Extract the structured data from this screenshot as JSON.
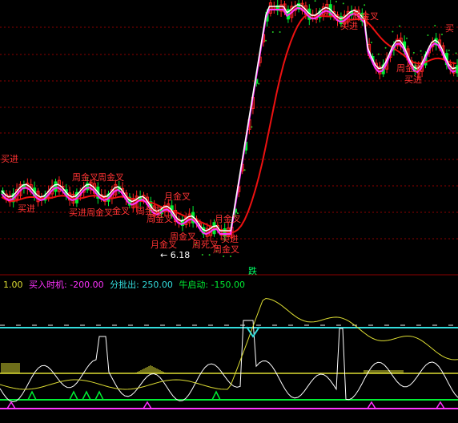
{
  "colors": {
    "background": "#000000",
    "grid": "#8b0000",
    "up_candle": "#ff2222",
    "down_candle": "#00ee33",
    "ma_white": "#ffffff",
    "ma_magenta": "#ff33ff",
    "ma_red": "#ee1111",
    "dots": "#22cc22",
    "cyan": "#33dddd",
    "yellow": "#dddd33",
    "green_line": "#00ee33",
    "magenta_line": "#ff33ff"
  },
  "main_chart": {
    "annotations": [
      {
        "id": "a1",
        "text": "买进"
      },
      {
        "id": "a2",
        "text": "买进"
      },
      {
        "id": "a3",
        "text": "周金叉"
      },
      {
        "id": "a4",
        "text": "周金叉"
      },
      {
        "id": "a5",
        "text": "月金叉"
      },
      {
        "id": "a6",
        "text": "月金叉"
      },
      {
        "id": "a7",
        "text": "买进"
      },
      {
        "id": "a8",
        "text": "周金叉"
      },
      {
        "id": "a9",
        "text": "周金叉"
      },
      {
        "id": "a10",
        "text": "周金叉"
      },
      {
        "id": "a11",
        "text": "月金叉"
      },
      {
        "id": "a12",
        "text": "周死叉"
      },
      {
        "id": "a13",
        "text": "买进"
      },
      {
        "id": "a14",
        "text": "周金叉"
      },
      {
        "id": "a15",
        "text": "周金叉"
      },
      {
        "id": "a16",
        "text": "买进"
      },
      {
        "id": "a17",
        "text": "周金叉"
      },
      {
        "id": "a18",
        "text": "买进"
      },
      {
        "id": "a19",
        "text": "买"
      },
      {
        "id": "a20",
        "text": "周金叉"
      },
      {
        "id": "a21",
        "text": "金叉"
      }
    ],
    "low_marker": "← 6.18",
    "bottom_label": "跌"
  },
  "indicator": {
    "value": "1.00",
    "legend": [
      {
        "label": "买入时机: -200.00",
        "color": "#ff33ff"
      },
      {
        "label": "分批出: 250.00",
        "color": "#33dddd"
      },
      {
        "label": "牛启动: -150.00",
        "color": "#00ee33"
      }
    ]
  }
}
